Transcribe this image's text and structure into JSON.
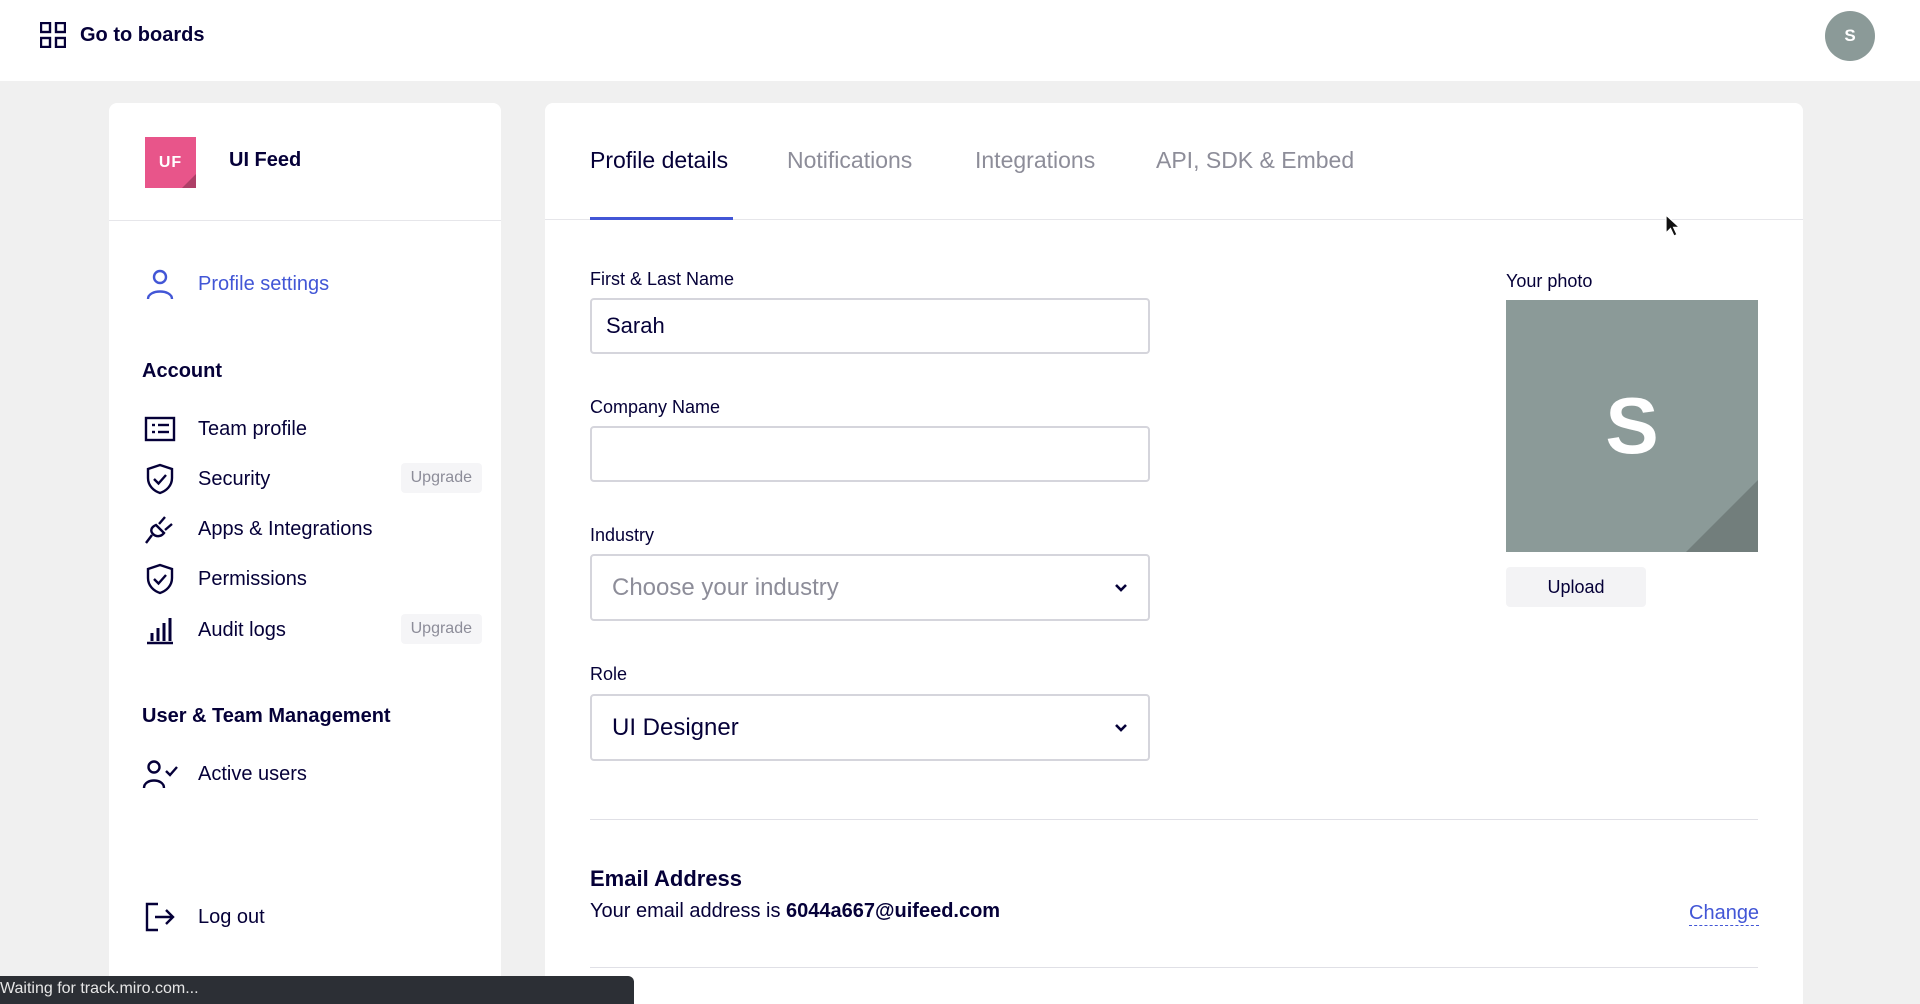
{
  "topbar": {
    "goto_label": "Go to boards",
    "avatar_initial": "S"
  },
  "sidebar": {
    "team": {
      "initials": "UF",
      "name": "UI Feed",
      "color": "#e8558a"
    },
    "profile_settings": "Profile settings",
    "account_heading": "Account",
    "account_items": [
      {
        "label": "Team profile",
        "icon": "id-card-icon"
      },
      {
        "label": "Security",
        "icon": "shield-check-icon",
        "badge": "Upgrade"
      },
      {
        "label": "Apps & Integrations",
        "icon": "plug-icon"
      },
      {
        "label": "Permissions",
        "icon": "shield-check-icon"
      },
      {
        "label": "Audit logs",
        "icon": "bar-chart-icon",
        "badge": "Upgrade"
      }
    ],
    "management_heading": "User & Team Management",
    "management_items": [
      {
        "label": "Active users",
        "icon": "user-check-icon"
      }
    ],
    "logout_label": "Log out"
  },
  "tabs": [
    {
      "label": "Profile details",
      "active": true
    },
    {
      "label": "Notifications"
    },
    {
      "label": "Integrations"
    },
    {
      "label": "API, SDK & Embed"
    }
  ],
  "form": {
    "name_label": "First & Last Name",
    "name_value": "Sarah",
    "company_label": "Company Name",
    "company_value": "",
    "industry_label": "Industry",
    "industry_placeholder": "Choose your industry",
    "role_label": "Role",
    "role_value": "UI Designer"
  },
  "photo": {
    "label": "Your photo",
    "initial": "S",
    "upload_label": "Upload",
    "color": "#8b9a98"
  },
  "email": {
    "title": "Email Address",
    "prefix": "Your email address is",
    "address": "6044a667@uifeed.com",
    "change_label": "Change"
  },
  "status_bar": "Waiting for track.miro.com...",
  "colors": {
    "accent": "#4256d6",
    "text": "#050038",
    "muted": "#8d8d99"
  }
}
